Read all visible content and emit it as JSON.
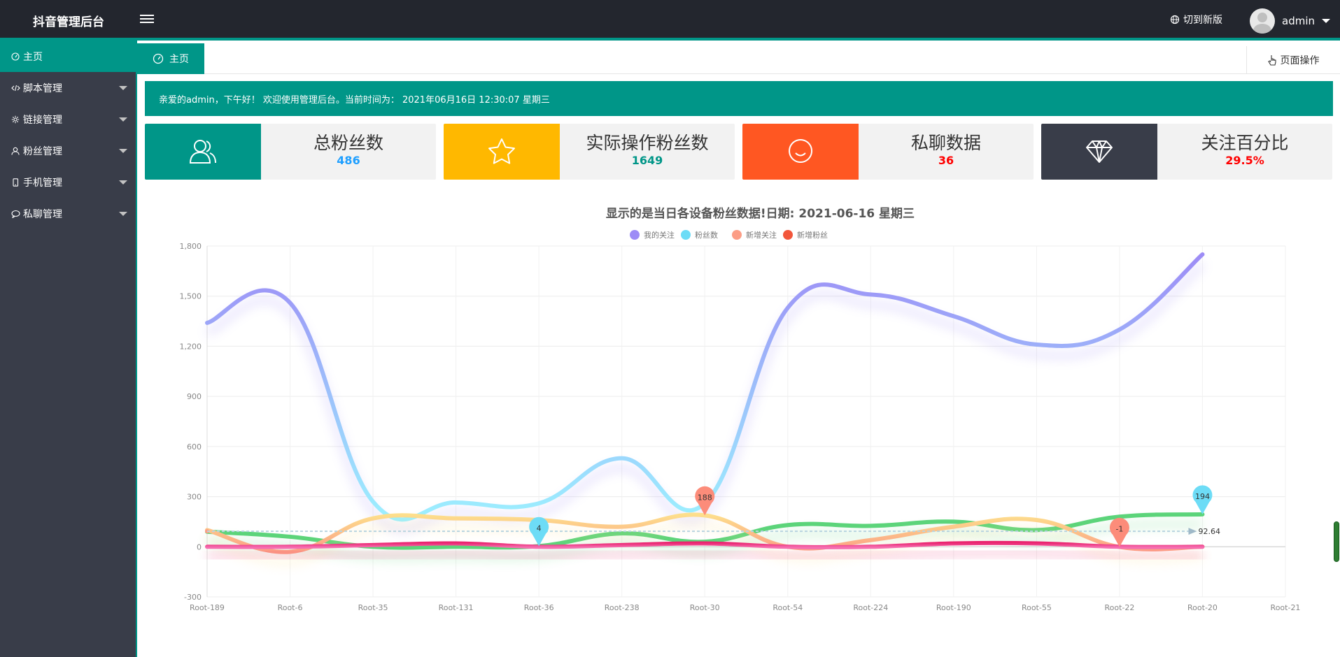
{
  "app": {
    "title": "抖音管理后台",
    "new_version": "切到新版",
    "username": "admin"
  },
  "sidebar": {
    "items": [
      {
        "label": "主页",
        "icon": "gauge-icon",
        "active": true,
        "has_arrow": false
      },
      {
        "label": "脚本管理",
        "icon": "code-icon",
        "active": false,
        "has_arrow": true
      },
      {
        "label": "链接管理",
        "icon": "gear-icon",
        "active": false,
        "has_arrow": true
      },
      {
        "label": "粉丝管理",
        "icon": "user-icon",
        "active": false,
        "has_arrow": true
      },
      {
        "label": "手机管理",
        "icon": "phone-icon",
        "active": false,
        "has_arrow": true
      },
      {
        "label": "私聊管理",
        "icon": "chat-icon",
        "active": false,
        "has_arrow": true
      }
    ]
  },
  "tabs": {
    "home_label": "主页",
    "page_ops": "页面操作"
  },
  "welcome": "亲爱的admin，下午好！ 欢迎使用管理后台。当前时间为： 2021年06月16日 12:30:07    星期三",
  "cards": [
    {
      "title": "总粉丝数",
      "value": "486",
      "icon": "users-icon",
      "bg": "#009688",
      "value_color": "#1e9fff"
    },
    {
      "title": "实际操作粉丝数",
      "value": "1649",
      "icon": "star-icon",
      "bg": "#ffb800",
      "value_color": "#009688"
    },
    {
      "title": "私聊数据",
      "value": "36",
      "icon": "smile-icon",
      "bg": "#ff5722",
      "value_color": "#ff0000"
    },
    {
      "title": "关注百分比",
      "value": "29.5%",
      "icon": "diamond-icon",
      "bg": "#393d49",
      "value_color": "#ff0000"
    }
  ],
  "chart_data": {
    "type": "line",
    "title": "显示的是当日各设备粉丝数据!日期: 2021-06-16   星期三",
    "categories": [
      "Root-189",
      "Root-6",
      "Root-35",
      "Root-131",
      "Root-36",
      "Root-238",
      "Root-30",
      "Root-54",
      "Root-224",
      "Root-190",
      "Root-55",
      "Root-22",
      "Root-20",
      "Root-21"
    ],
    "ylim": [
      -300,
      1800
    ],
    "yticks": [
      -300,
      0,
      300,
      600,
      900,
      1200,
      1500,
      1800
    ],
    "legend": {
      "position": "top-center"
    },
    "series": [
      {
        "name": "我的关注",
        "color_start": "#9d8cf6",
        "color_end": "#9cf0ff",
        "values": [
          1340,
          1460,
          270,
          265,
          260,
          530,
          260,
          1430,
          1510,
          1380,
          1210,
          1300,
          1750
        ]
      },
      {
        "name": "粉丝数",
        "color_start": "#5cd47a",
        "color_end": "#5cd47a",
        "values": [
          90,
          60,
          0,
          0,
          4,
          80,
          30,
          130,
          125,
          150,
          100,
          180,
          194
        ]
      },
      {
        "name": "新增关注",
        "color_start": "#fddf8c",
        "color_end": "#fc9d85",
        "values": [
          100,
          -30,
          170,
          170,
          160,
          120,
          188,
          0,
          40,
          120,
          160,
          -1,
          0
        ]
      },
      {
        "name": "新增粉丝",
        "color_start": "#ea2570",
        "color_end": "#f56fb0",
        "values": [
          0,
          0,
          10,
          20,
          0,
          10,
          20,
          0,
          0,
          20,
          20,
          0,
          0
        ]
      }
    ],
    "legend_colors": [
      "#9d8cf6",
      "#6ddcf6",
      "#fc9d85",
      "#f2563b"
    ],
    "mark_points": [
      {
        "series": "粉丝数",
        "category": "Root-36",
        "label": "4",
        "color": "#6ddcf6"
      },
      {
        "series": "新增关注",
        "category": "Root-30",
        "label": "188",
        "color": "#fc8c7a"
      },
      {
        "series": "新增关注",
        "category": "Root-22",
        "label": "-1",
        "color": "#fc8c7a"
      },
      {
        "series": "粉丝数",
        "category": "Root-20",
        "label": "194",
        "color": "#6ddcf6"
      }
    ],
    "mark_line": {
      "value": 92.64,
      "label": "92.64"
    }
  }
}
